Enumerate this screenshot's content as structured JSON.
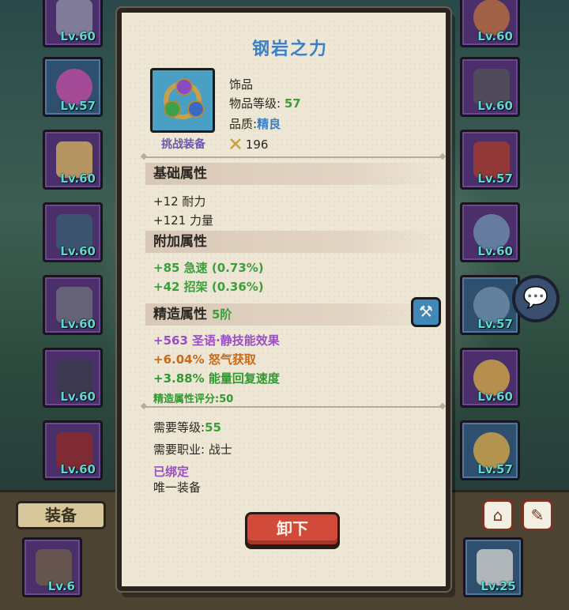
{
  "background": {
    "left_slots": [
      {
        "level": "Lv.60",
        "icon": "horn-icon"
      },
      {
        "level": "Lv.57",
        "icon": "heart-amulet-icon"
      },
      {
        "level": "Lv.60",
        "icon": "shoulder-armor-icon"
      },
      {
        "level": "Lv.60",
        "icon": "chest-armor-icon"
      },
      {
        "level": "Lv.60",
        "icon": "cloak-icon"
      },
      {
        "level": "Lv.60",
        "icon": "bracer-icon"
      },
      {
        "level": "Lv.60",
        "icon": "gauntlet-icon"
      }
    ],
    "right_slots": [
      {
        "level": "Lv.60",
        "icon": "belt-icon"
      },
      {
        "level": "Lv.60",
        "icon": "pants-icon"
      },
      {
        "level": "Lv.57",
        "icon": "boots-icon"
      },
      {
        "level": "Lv.60",
        "icon": "ring-icon"
      },
      {
        "level": "Lv.57",
        "icon": "ring-icon"
      },
      {
        "level": "Lv.60",
        "icon": "trinket-icon"
      },
      {
        "level": "Lv.57",
        "icon": "trinket-icon"
      }
    ],
    "bottom_slots": [
      {
        "level": "Lv.6"
      },
      {
        "level": "Lv.25"
      }
    ],
    "equip_tab_label": "装备"
  },
  "popup": {
    "title": "钢岩之力",
    "item_caption": "挑战装备",
    "item_type": "饰品",
    "item_level_label": "物品等级:",
    "item_level_value": "57",
    "quality_label": "品质:",
    "quality_value": "精良",
    "power_value": "196",
    "sections": {
      "base": "基础属性",
      "bonus": "附加属性",
      "forge": "精造属性",
      "forge_tier": "5阶"
    },
    "base_stats": [
      "+12 耐力",
      "+121 力量"
    ],
    "bonus_stats": [
      "+85 急速 (0.73%)",
      "+42 招架 (0.36%)"
    ],
    "forge_stats": [
      "+563 圣语·静技能效果",
      "+6.04% 怒气获取",
      "+3.88% 能量回复速度"
    ],
    "forge_score": "精造属性评分:50",
    "required_level_label": "需要等级:",
    "required_level_value": "55",
    "required_class": "需要职业: 战士",
    "bound": "已绑定",
    "unique": "唯一装备",
    "unequip_label": "卸下"
  },
  "colors": {
    "title": "#3b7fc4",
    "green_stat": "#3aa03a",
    "purple_stat": "#9a4ec4",
    "orange_stat": "#c86a18",
    "button_red": "#d24a3a"
  }
}
